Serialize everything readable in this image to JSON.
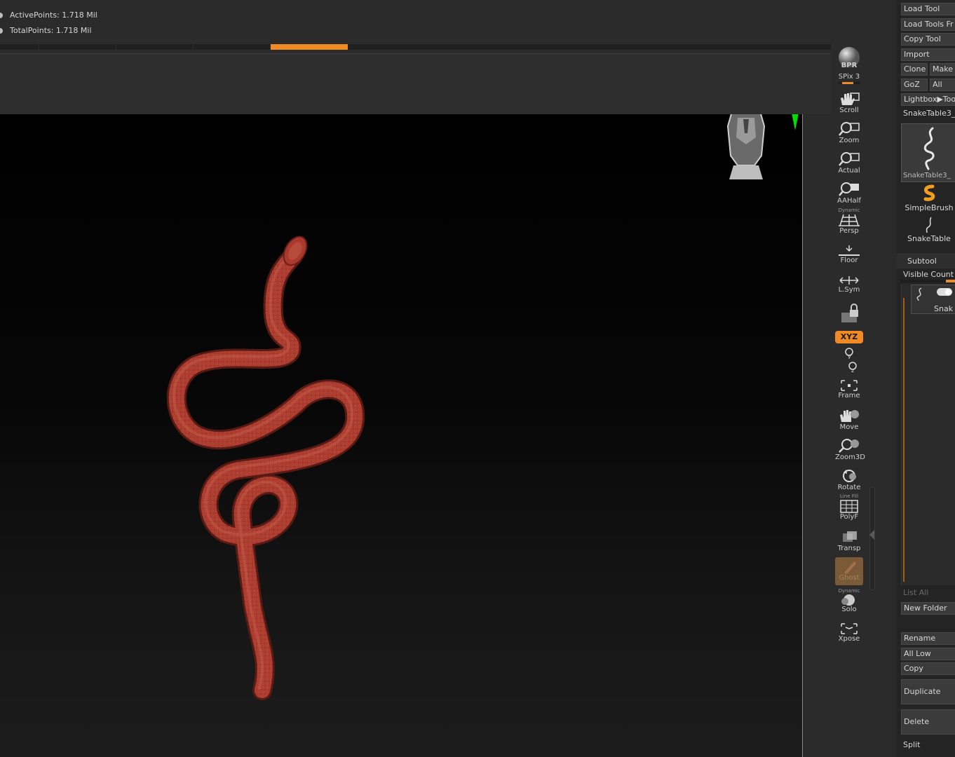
{
  "stats": {
    "active_points": "ActivePoints: 1.718 Mil",
    "total_points": "TotalPoints: 1.718 Mil"
  },
  "progress": {
    "segments": 5,
    "active_segment": 4,
    "accent": "#f08a24"
  },
  "toolbar": {
    "bpr": "BPR",
    "spix": "SPix 3",
    "scroll": "Scroll",
    "zoom": "Zoom",
    "actual": "Actual",
    "aahalf": "AAHalf",
    "persp_sub": "Dynamic",
    "persp": "Persp",
    "floor": "Floor",
    "lsym": "L.Sym",
    "xyz": "XYZ",
    "frame": "Frame",
    "move": "Move",
    "zoom3d": "Zoom3D",
    "rotate": "Rotate",
    "polyf_sub": "Line Fill",
    "polyf": "PolyF",
    "transp": "Transp",
    "ghost": "Ghost",
    "solo_sub": "Dynamic",
    "solo": "Solo",
    "xpose": "Xpose"
  },
  "panel": {
    "load_tool": "Load Tool",
    "load_tools_from": "Load Tools Fr",
    "copy_tool": "Copy Tool",
    "import": "Import",
    "clone": "Clone",
    "make": "Make",
    "goz": "GoZ",
    "all": "All",
    "lightbox_tools": "Lightbox▶Too",
    "current_tool": "SnakeTable3_",
    "thumb_label": "SnakeTable3_",
    "simple_brush": "SimpleBrush",
    "snake_table": "SnakeTable",
    "subtool_title": "Subtool",
    "visible_count": "Visible Count",
    "subtool_item": "Snak",
    "list_all": "List All",
    "new_folder": "New Folder",
    "rename": "Rename",
    "all_low": "All Low",
    "copy": "Copy",
    "duplicate": "Duplicate",
    "delete": "Delete",
    "split": "Split"
  },
  "colors": {
    "accent": "#f08a24",
    "snake": "#a8392c",
    "gizmo_x": "#ff0000",
    "gizmo_y": "#00e000",
    "gizmo_z": "#0000ff"
  }
}
